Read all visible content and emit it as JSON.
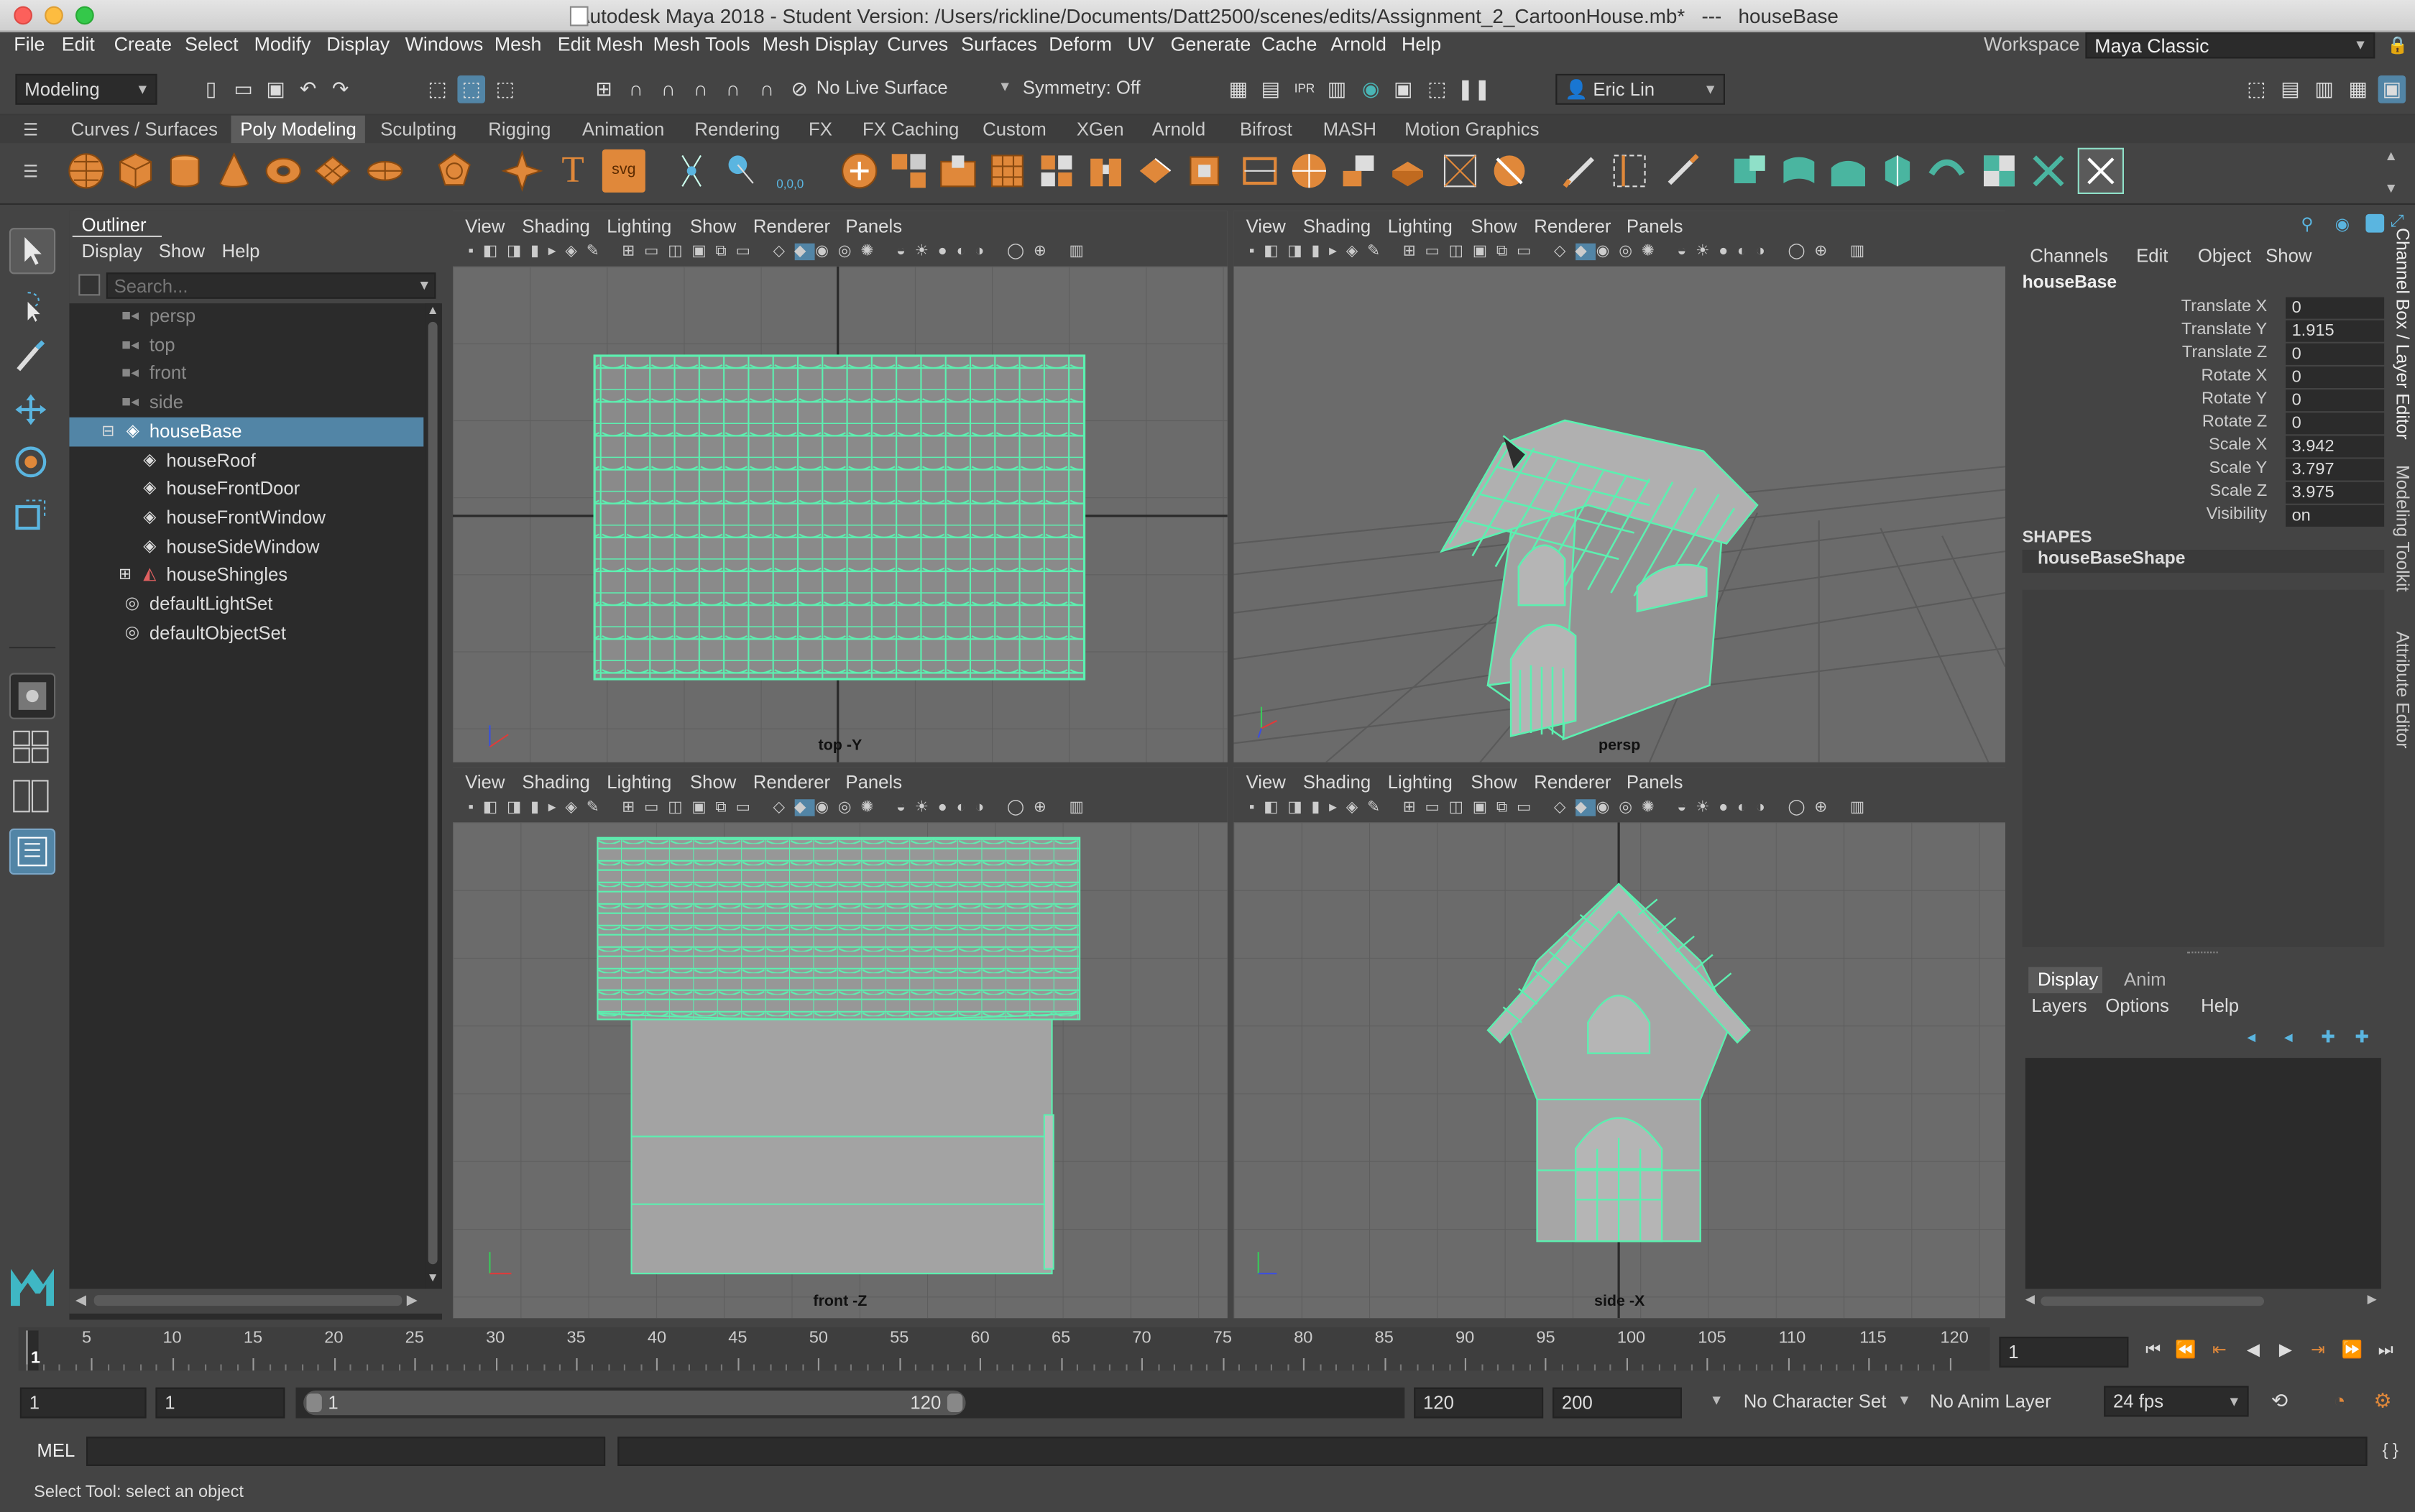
{
  "window": {
    "title": "Autodesk Maya 2018 - Student Version: /Users/rickline/Documents/Datt2500/scenes/edits/Assignment_2_CartoonHouse.mb*   ---   houseBase"
  },
  "menubar": {
    "items": [
      "File",
      "Edit",
      "Create",
      "Select",
      "Modify",
      "Display",
      "Windows",
      "Mesh",
      "Edit Mesh",
      "Mesh Tools",
      "Mesh Display",
      "Curves",
      "Surfaces",
      "Deform",
      "UV",
      "Generate",
      "Cache",
      "Arnold",
      "Help"
    ]
  },
  "workspace": {
    "label": "Workspace :",
    "value": "Maya Classic"
  },
  "statusline": {
    "mode": "Modeling",
    "live_surface": "No Live Surface",
    "symmetry": "Symmetry: Off",
    "user": "Eric Lin"
  },
  "shelf": {
    "tabs": [
      "Curves / Surfaces",
      "Poly Modeling",
      "Sculpting",
      "Rigging",
      "Animation",
      "Rendering",
      "FX",
      "FX Caching",
      "Custom",
      "XGen",
      "Arnold",
      "Bifrost",
      "MASH",
      "Motion Graphics"
    ],
    "active_tab": "Poly Modeling",
    "text_icon_t": "T",
    "text_icon_svg": "svg",
    "snap_label": "0,0,0"
  },
  "outliner": {
    "title": "Outliner",
    "menu": [
      "Display",
      "Show",
      "Help"
    ],
    "search_placeholder": "Search...",
    "items": [
      "persp",
      "top",
      "front",
      "side",
      "houseBase",
      "houseRoof",
      "houseFrontDoor",
      "houseFrontWindow",
      "houseSideWindow",
      "houseShingles",
      "defaultLightSet",
      "defaultObjectSet"
    ]
  },
  "viewports": {
    "menu": [
      "View",
      "Shading",
      "Lighting",
      "Show",
      "Renderer",
      "Panels"
    ],
    "names": [
      "top -Y",
      "persp",
      "front -Z",
      "side -X"
    ]
  },
  "channelbox": {
    "menu": [
      "Channels",
      "Edit",
      "Object",
      "Show"
    ],
    "object": "houseBase",
    "channels": [
      {
        "name": "Translate X",
        "value": "0"
      },
      {
        "name": "Translate Y",
        "value": "1.915"
      },
      {
        "name": "Translate Z",
        "value": "0"
      },
      {
        "name": "Rotate X",
        "value": "0"
      },
      {
        "name": "Rotate Y",
        "value": "0"
      },
      {
        "name": "Rotate Z",
        "value": "0"
      },
      {
        "name": "Scale X",
        "value": "3.942"
      },
      {
        "name": "Scale Y",
        "value": "3.797"
      },
      {
        "name": "Scale Z",
        "value": "3.975"
      },
      {
        "name": "Visibility",
        "value": "on"
      }
    ],
    "shapes_header": "SHAPES",
    "shape": "houseBaseShape",
    "side_tabs": [
      "Channel Box / Layer Editor",
      "Modeling Toolkit",
      "Attribute Editor"
    ]
  },
  "layer_editor": {
    "tabs": [
      "Display",
      "Anim"
    ],
    "menu": [
      "Layers",
      "Options",
      "Help"
    ]
  },
  "timeline": {
    "ticks": [
      "5",
      "10",
      "15",
      "20",
      "25",
      "30",
      "35",
      "40",
      "45",
      "50",
      "55",
      "60",
      "65",
      "70",
      "75",
      "80",
      "85",
      "90",
      "95",
      "100",
      "105",
      "110",
      "115",
      "120"
    ],
    "current_marker": "1",
    "current_frame": "1"
  },
  "range": {
    "start": "1",
    "playback_start": "1",
    "slider_start": "1",
    "slider_end": "120",
    "playback_end": "120",
    "end": "200",
    "character_set": "No Character Set",
    "anim_layer": "No Anim Layer",
    "fps": "24 fps"
  },
  "mel": {
    "label": "MEL"
  },
  "help": {
    "text": "Select Tool: select an object"
  },
  "colors": {
    "wire": "#5cf0b0",
    "selection": "#5285a6",
    "accent": "#4ab5b5",
    "shelf_orange": "#e0883a"
  }
}
